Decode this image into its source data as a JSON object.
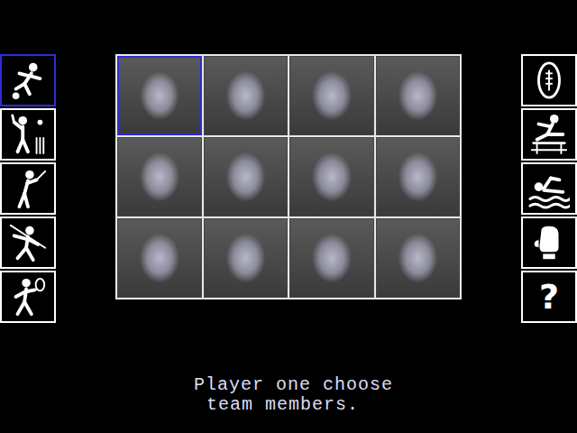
{
  "left_icons": [
    {
      "kind": "football",
      "selected": true
    },
    {
      "kind": "cricket",
      "selected": false
    },
    {
      "kind": "golf",
      "selected": false
    },
    {
      "kind": "javelin",
      "selected": false
    },
    {
      "kind": "tennis",
      "selected": false
    }
  ],
  "right_icons": [
    {
      "kind": "rugby",
      "label": "",
      "selected": false
    },
    {
      "kind": "hurdles",
      "label": "",
      "selected": false
    },
    {
      "kind": "swimming",
      "label": "",
      "selected": false
    },
    {
      "kind": "boxing",
      "label": "",
      "selected": false
    },
    {
      "kind": "help",
      "label": "?",
      "selected": false
    }
  ],
  "portraits": [
    {
      "selected": true
    },
    {
      "selected": false
    },
    {
      "selected": false
    },
    {
      "selected": false
    },
    {
      "selected": false
    },
    {
      "selected": false
    },
    {
      "selected": false
    },
    {
      "selected": false
    },
    {
      "selected": false
    },
    {
      "selected": false
    },
    {
      "selected": false
    },
    {
      "selected": false
    }
  ],
  "message": {
    "lines": [
      "Player one choose",
      "team members."
    ]
  }
}
